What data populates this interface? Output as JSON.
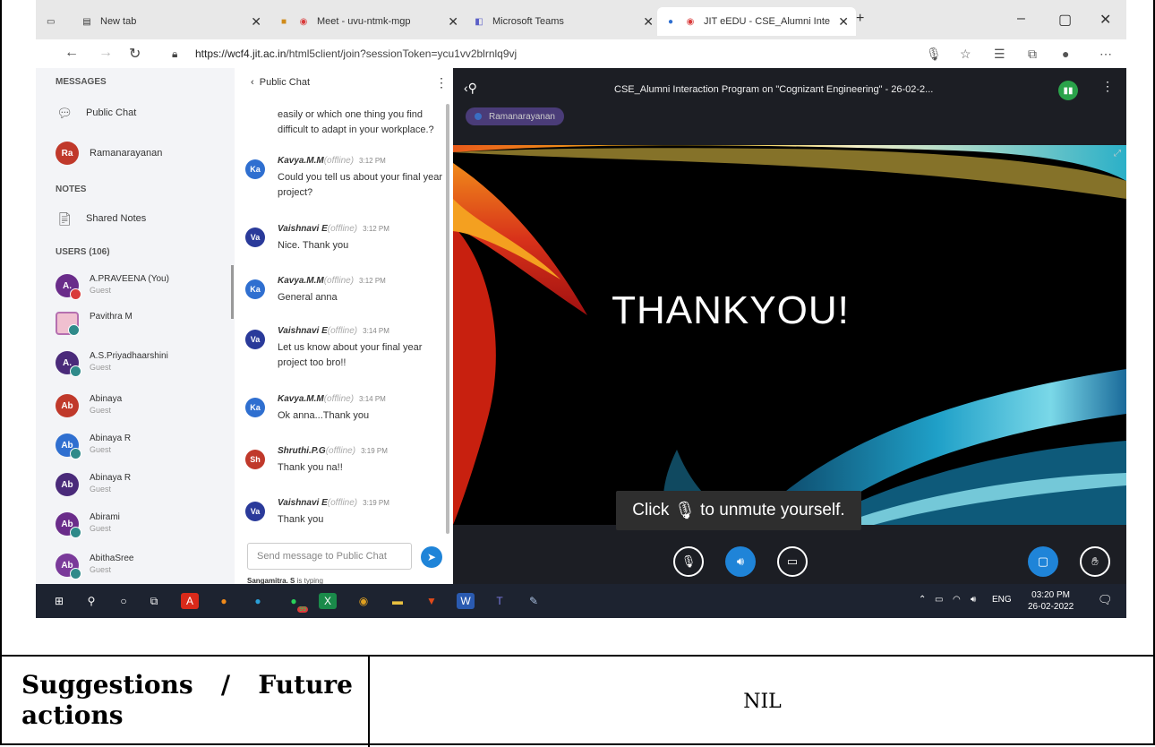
{
  "browser": {
    "tabs": [
      {
        "label": "New tab"
      },
      {
        "label": "Meet - uvu-ntmk-mgp"
      },
      {
        "label": "Microsoft Teams"
      },
      {
        "label": "JIT eEDU - CSE_Alumni Inte"
      }
    ],
    "url_host": "https://wcf4.jit.ac.in",
    "url_path": "/html5client/join?sessionToken=ycu1vv2blrnlq9vj"
  },
  "messages_panel": {
    "section_messages": "MESSAGES",
    "public_chat": "Public Chat",
    "private_chat_user": "Ramanarayanan",
    "private_chat_initials": "Ra",
    "section_notes": "NOTES",
    "shared_notes": "Shared Notes",
    "section_users": "USERS (106)",
    "users": [
      {
        "initials": "A.",
        "name": "A.PRAVEENA (You)",
        "role": "Guest",
        "color": "#6a2c8a"
      },
      {
        "initials": "",
        "name": "Pavithra M",
        "role": "",
        "color": "#b56fb0"
      },
      {
        "initials": "A.",
        "name": "A.S.Priyadhaarshini",
        "role": "Guest",
        "color": "#4a2a7a"
      },
      {
        "initials": "Ab",
        "name": "Abinaya",
        "role": "Guest",
        "color": "#c0392b"
      },
      {
        "initials": "Ab",
        "name": "Abinaya R",
        "role": "Guest",
        "color": "#2f6fd0"
      },
      {
        "initials": "Ab",
        "name": "Abinaya R",
        "role": "Guest",
        "color": "#4a2a7a"
      },
      {
        "initials": "Ab",
        "name": "Abirami",
        "role": "Guest",
        "color": "#6a2c8a"
      },
      {
        "initials": "Ab",
        "name": "AbithaSree",
        "role": "Guest",
        "color": "#7a3a9a"
      }
    ]
  },
  "chat": {
    "header": "Public Chat",
    "top_text": "easily or which one thing you find difficult to adapt in your workplace.?",
    "offline": "(offline)",
    "messages": [
      {
        "initials": "Ka",
        "color": "#2f6fd0",
        "author": "Kavya.M.M",
        "time": "3:12 PM",
        "text": "Could you tell us about your final year project?"
      },
      {
        "initials": "Va",
        "color": "#2a3a9a",
        "author": "Vaishnavi E",
        "time": "3:12 PM",
        "text": "Nice. Thank you"
      },
      {
        "initials": "Ka",
        "color": "#2f6fd0",
        "author": "Kavya.M.M",
        "time": "3:12 PM",
        "text": "General anna"
      },
      {
        "initials": "Va",
        "color": "#2a3a9a",
        "author": "Vaishnavi E",
        "time": "3:14 PM",
        "text": "Let us know about your final year project too bro!!"
      },
      {
        "initials": "Ka",
        "color": "#2f6fd0",
        "author": "Kavya.M.M",
        "time": "3:14 PM",
        "text": "Ok anna...Thank you"
      },
      {
        "initials": "Sh",
        "color": "#c0392b",
        "author": "Shruthi.P.G",
        "time": "3:19 PM",
        "text": "Thank you na!!"
      },
      {
        "initials": "Va",
        "color": "#2a3a9a",
        "author": "Vaishnavi E",
        "time": "3:19 PM",
        "text": "Thank you"
      }
    ],
    "input_placeholder": "Send message to Public Chat",
    "typing_user": "Sangamitra. S",
    "typing_suffix": "is typing"
  },
  "stage": {
    "title": "CSE_Alumni Interaction Program on \"Cognizant Engineering\" - 26-02-2...",
    "talker": "Ramanarayanan",
    "slide_text": "THANKYOU!",
    "unmute_tip_pre": "Click",
    "unmute_tip_post": "to unmute yourself."
  },
  "taskbar": {
    "lang": "ENG",
    "time": "03:20 PM",
    "date": "26-02-2022",
    "whatsapp_badge": "99"
  },
  "document": {
    "label_line1": "Suggestions / Future",
    "label_line2": "actions",
    "value": "NIL"
  }
}
